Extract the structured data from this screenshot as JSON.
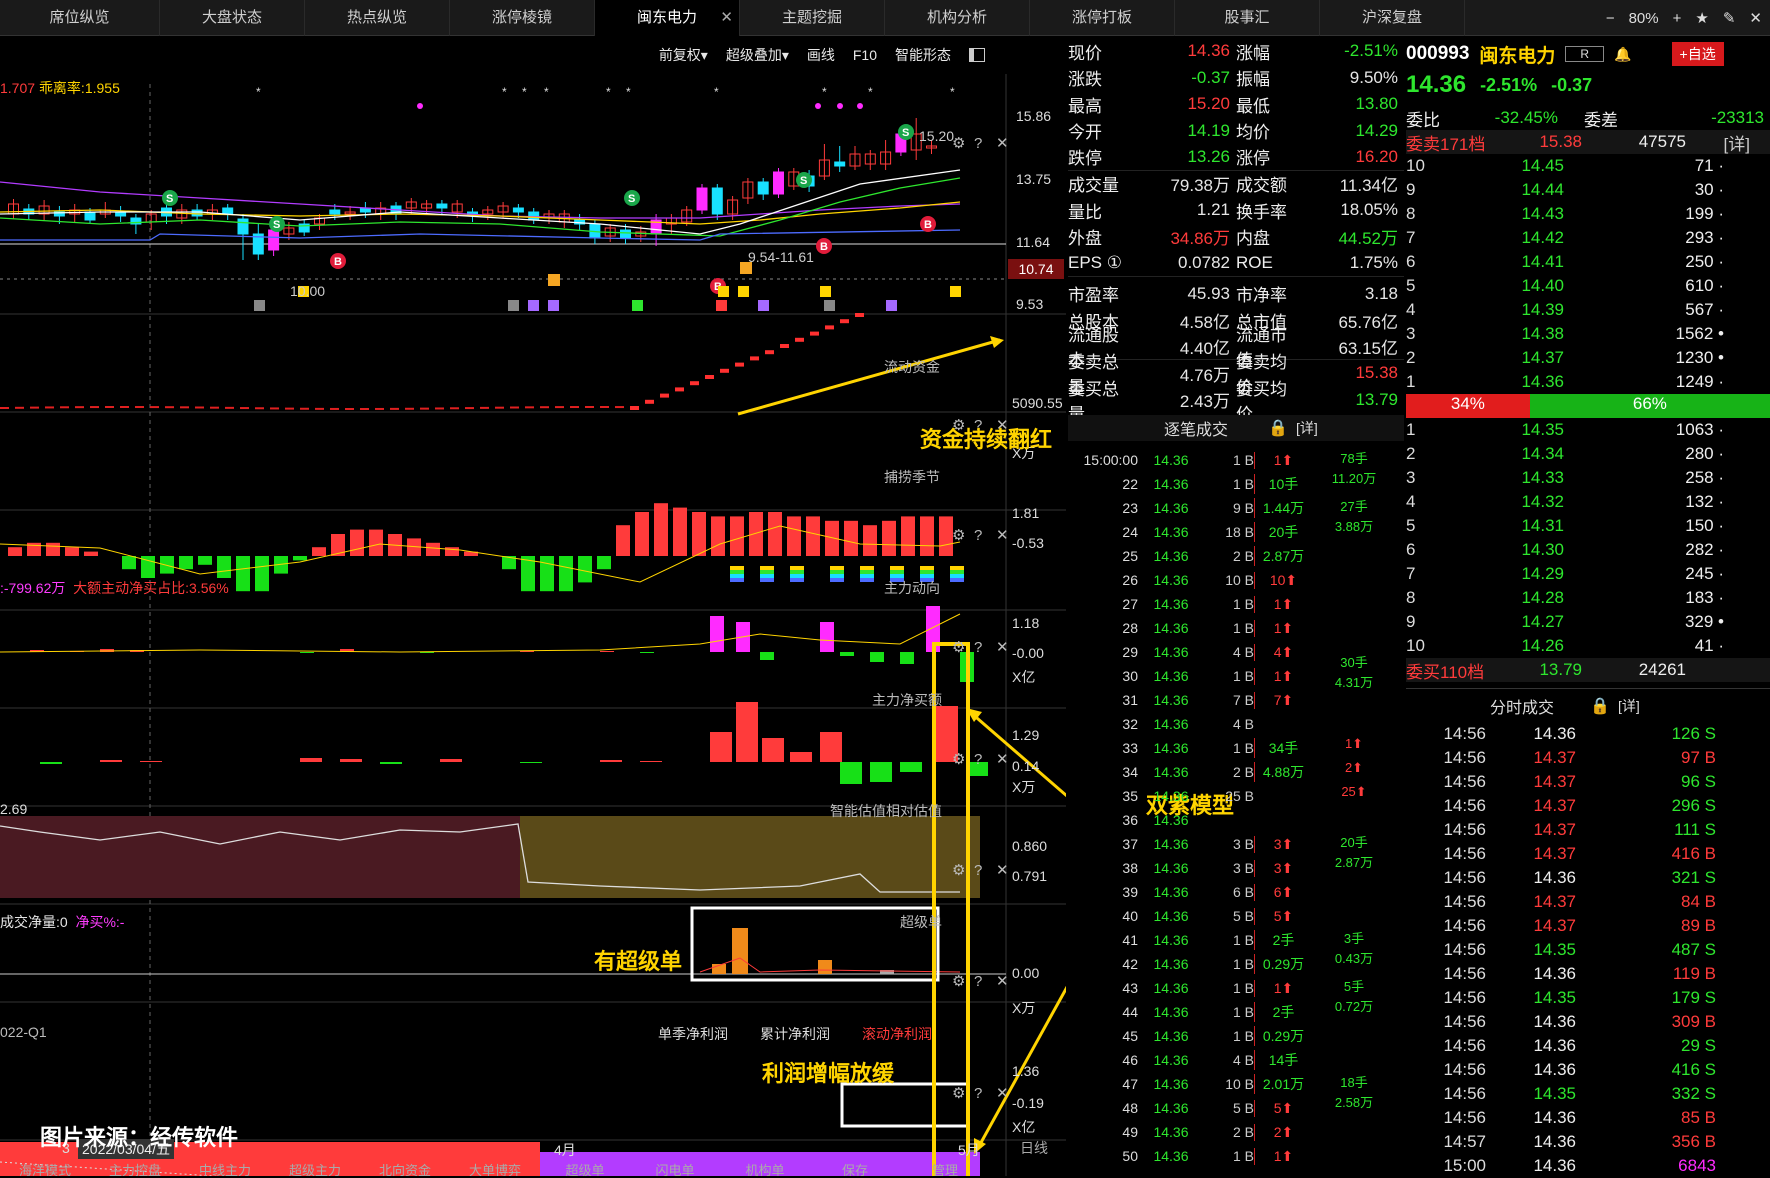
{
  "tabs": [
    "席位纵览",
    "大盘状态",
    "热点纵览",
    "涨停棱镜",
    "闽东电力",
    "主题挖掘",
    "机构分析",
    "涨停打板",
    "股事汇",
    "沪深复盘"
  ],
  "active_tab": "闽东电力",
  "window": {
    "zoom": "80%",
    "minus": "−",
    "plus": "+",
    "star": "★",
    "pen": "✎",
    "close": "✕"
  },
  "toolbar": {
    "fq": "前复权▾",
    "overlay": "超级叠加▾",
    "draw": "画线",
    "f10": "F10",
    "pattern": "智能形态"
  },
  "kline": {
    "top_label_val": "1.707",
    "bias": "乖离率:1.955",
    "y_labels": [
      "15.86",
      "13.75",
      "11.64",
      "9.53"
    ],
    "current": "10.74",
    "high_note": "15.20",
    "low_note": "10.00",
    "mid_note": "9.54-11.61"
  },
  "panels": {
    "flow": {
      "title": "流动资金",
      "y": "5090.55",
      "unit": "X万",
      "tail": "2"
    },
    "season": {
      "title": "捕捞季节",
      "y": [
        "1.81",
        "-0.53"
      ]
    },
    "main": {
      "title": "主力动向",
      "left": ":-799.62万",
      "left2": "大额主动净买占比:3.56%",
      "y": [
        "1.18",
        "-0.00"
      ],
      "unit": "X亿"
    },
    "netbuy": {
      "title": "主力净买额",
      "y": [
        "1.29",
        "0.14"
      ],
      "unit": "X万"
    },
    "valuation": {
      "title": "智能估值相对估值",
      "left": "2.69",
      "y": [
        "0.860",
        "0.791"
      ]
    },
    "super": {
      "title": "超级单",
      "left": "成交净量:0",
      "left2": "净买%:-",
      "y": "0.00",
      "unit": "X万"
    },
    "profit": {
      "left": "022-Q1",
      "t1": "单季净利润",
      "t2": "累计净利润",
      "t3": "滚动净利润",
      "y": [
        "1.36",
        "-0.19"
      ],
      "unit": "X亿"
    }
  },
  "xaxis": {
    "d1": "3",
    "date": "2022/03/04/五",
    "apr": "4月",
    "may": "5月",
    "period": "日线"
  },
  "bottom_tabs": [
    "海洋模式",
    "主力控盘",
    "中线主力",
    "超级主力",
    "北向资金",
    "大单博弈",
    "超级单",
    "闪电单",
    "机构单",
    "保存",
    "管理"
  ],
  "annotations": {
    "a1": "资金持续翻红",
    "a2": "双紫模型",
    "a3": "有超级单",
    "a4": "利润增幅放缓",
    "source": "图片来源：经传软件"
  },
  "quote": [
    [
      "现价",
      "14.36",
      "red",
      "涨幅",
      "-2.51%",
      "green"
    ],
    [
      "涨跌",
      "-0.37",
      "green",
      "振幅",
      "9.50%",
      "wht"
    ],
    [
      "最高",
      "15.20",
      "red",
      "最低",
      "13.80",
      "green"
    ],
    [
      "今开",
      "14.19",
      "green",
      "均价",
      "14.29",
      "green"
    ],
    [
      "跌停",
      "13.26",
      "green",
      "涨停",
      "16.20",
      "red"
    ],
    [
      "成交量",
      "79.38万",
      "wht",
      "成交额",
      "11.34亿",
      "wht"
    ],
    [
      "量比",
      "1.21",
      "wht",
      "换手率",
      "18.05%",
      "wht"
    ],
    [
      "外盘",
      "34.86万",
      "red",
      "内盘",
      "44.52万",
      "green"
    ],
    [
      "EPS ①",
      "0.0782",
      "wht",
      "ROE",
      "1.75%",
      "wht"
    ],
    [
      "市盈率",
      "45.93",
      "wht",
      "市净率",
      "3.18",
      "wht"
    ],
    [
      "总股本",
      "4.58亿",
      "wht",
      "总市值",
      "65.76亿",
      "wht"
    ],
    [
      "流通股本",
      "4.40亿",
      "wht",
      "流通市值",
      "63.15亿",
      "wht"
    ],
    [
      "委卖总量",
      "4.76万",
      "wht",
      "委卖均价",
      "15.38",
      "red"
    ],
    [
      "委买总量",
      "2.43万",
      "wht",
      "委买均价",
      "13.79",
      "green"
    ]
  ],
  "stock": {
    "code": "000993",
    "name": "闽东电力",
    "r": "R",
    "price": "14.36",
    "chg_pct": "-2.51%",
    "chg": "-0.37",
    "add": "+自选"
  },
  "ob": {
    "wb_label": "委比",
    "wb": "-32.45%",
    "wc_label": "委差",
    "wc": "-23313",
    "sell_head": "委卖171档",
    "sell_head_p": "15.38",
    "sell_head_v": "47575",
    "detail": "[详]",
    "sells": [
      [
        "10",
        "14.45",
        "71"
      ],
      [
        "9",
        "14.44",
        "30"
      ],
      [
        "8",
        "14.43",
        "199"
      ],
      [
        "7",
        "14.42",
        "293"
      ],
      [
        "6",
        "14.41",
        "250"
      ],
      [
        "5",
        "14.40",
        "610"
      ],
      [
        "4",
        "14.39",
        "567"
      ],
      [
        "3",
        "14.38",
        "1562"
      ],
      [
        "2",
        "14.37",
        "1230"
      ],
      [
        "1",
        "14.36",
        "1249"
      ]
    ],
    "sell_pct": "34%",
    "buy_pct": "66%",
    "sell_ratio": 0.34,
    "buys": [
      [
        "1",
        "14.35",
        "1063"
      ],
      [
        "2",
        "14.34",
        "280"
      ],
      [
        "3",
        "14.33",
        "258"
      ],
      [
        "4",
        "14.32",
        "132"
      ],
      [
        "5",
        "14.31",
        "150"
      ],
      [
        "6",
        "14.30",
        "282"
      ],
      [
        "7",
        "14.29",
        "245"
      ],
      [
        "8",
        "14.28",
        "183"
      ],
      [
        "9",
        "14.27",
        "329"
      ],
      [
        "10",
        "14.26",
        "41"
      ]
    ],
    "buy_head": "委买110档",
    "buy_head_p": "13.79",
    "buy_head_v": "24261"
  },
  "fenshi": {
    "title": "分时成交",
    "detail": "[详]",
    "rows": [
      [
        "14:56",
        "14.36",
        "126 S"
      ],
      [
        "14:56",
        "14.37",
        "97 B"
      ],
      [
        "14:56",
        "14.37",
        "96 S"
      ],
      [
        "14:56",
        "14.37",
        "296 S"
      ],
      [
        "14:56",
        "14.37",
        "111 S"
      ],
      [
        "14:56",
        "14.37",
        "416 B"
      ],
      [
        "14:56",
        "14.36",
        "321 S"
      ],
      [
        "14:56",
        "14.37",
        "84 B"
      ],
      [
        "14:56",
        "14.37",
        "89 B"
      ],
      [
        "14:56",
        "14.35",
        "487 S"
      ],
      [
        "14:56",
        "14.36",
        "119 B"
      ],
      [
        "14:56",
        "14.35",
        "179 S"
      ],
      [
        "14:56",
        "14.36",
        "309 B"
      ],
      [
        "14:56",
        "14.36",
        "29 S"
      ],
      [
        "14:56",
        "14.36",
        "416 S"
      ],
      [
        "14:56",
        "14.35",
        "332 S"
      ],
      [
        "14:56",
        "14.36",
        "85 B"
      ],
      [
        "14:57",
        "14.36",
        "356 B"
      ],
      [
        "15:00",
        "14.36",
        "6843"
      ]
    ]
  },
  "zhubi": {
    "title": "逐笔成交",
    "detail": "[详]",
    "rows": [
      [
        "15:00:00",
        "14.36",
        "1 B",
        "1⬆"
      ],
      [
        "22",
        "14.36",
        "1 B",
        "10手"
      ],
      [
        "23",
        "14.36",
        "9 B",
        "1.44万"
      ],
      [
        "24",
        "14.36",
        "18 B",
        "20手"
      ],
      [
        "25",
        "14.36",
        "2 B",
        "2.87万"
      ],
      [
        "26",
        "14.36",
        "10 B",
        "10⬆"
      ],
      [
        "27",
        "14.36",
        "1 B",
        "1⬆"
      ],
      [
        "28",
        "14.36",
        "1 B",
        "1⬆"
      ],
      [
        "29",
        "14.36",
        "4 B",
        "4⬆"
      ],
      [
        "30",
        "14.36",
        "1 B",
        "1⬆"
      ],
      [
        "31",
        "14.36",
        "7 B",
        "7⬆"
      ],
      [
        "32",
        "14.36",
        "4 B",
        ""
      ],
      [
        "33",
        "14.36",
        "1 B",
        "34手"
      ],
      [
        "34",
        "14.36",
        "2 B",
        "4.88万"
      ],
      [
        "35",
        "14.36",
        "25 B",
        ""
      ],
      [
        "36",
        "14.36",
        "",
        ""
      ],
      [
        "37",
        "14.36",
        "3 B",
        "3⬆"
      ],
      [
        "38",
        "14.36",
        "3 B",
        "3⬆"
      ],
      [
        "39",
        "14.36",
        "6 B",
        "6⬆"
      ],
      [
        "40",
        "14.36",
        "5 B",
        "5⬆"
      ],
      [
        "41",
        "14.36",
        "1 B",
        "2手"
      ],
      [
        "42",
        "14.36",
        "1 B",
        "0.29万"
      ],
      [
        "43",
        "14.36",
        "1 B",
        "1⬆"
      ],
      [
        "44",
        "14.36",
        "1 B",
        "2手"
      ],
      [
        "45",
        "14.36",
        "1 B",
        "0.29万"
      ],
      [
        "46",
        "14.36",
        "4 B",
        "14手"
      ],
      [
        "47",
        "14.36",
        "10 B",
        "2.01万"
      ],
      [
        "48",
        "14.36",
        "5 B",
        "5⬆"
      ],
      [
        "49",
        "14.36",
        "2 B",
        "2⬆"
      ],
      [
        "50",
        "14.36",
        "1 B",
        "1⬆"
      ]
    ],
    "groups": [
      "78手",
      "11.20万",
      "27手",
      "3.88万",
      "30手",
      "4.31万",
      "1⬆",
      "2⬆",
      "25⬆",
      "20手",
      "2.87万",
      "3手",
      "0.43万",
      "5手",
      "0.72万",
      "18手",
      "2.58万"
    ]
  },
  "colors": {
    "red": "#ff3b3b",
    "green": "#2ee62e",
    "magenta": "#ff2bff",
    "cyan": "#18e0ff",
    "yellow": "#ffd400"
  }
}
